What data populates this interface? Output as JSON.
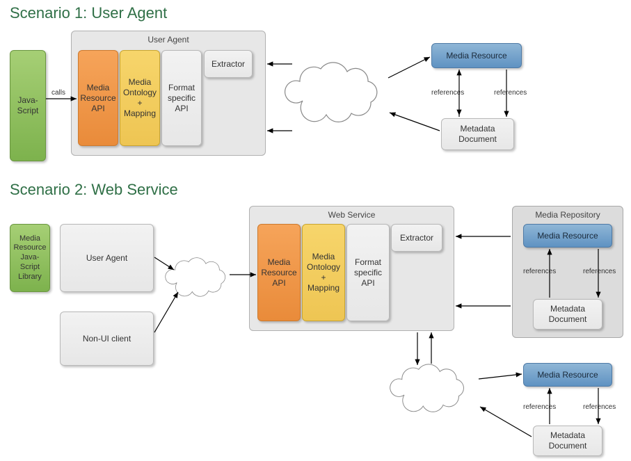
{
  "scenario1": {
    "title": "Scenario 1: User Agent",
    "javascript_box": "Java-\nScript",
    "panel_label": "User Agent",
    "media_resource_api": "Media\nResource\nAPI",
    "media_ontology_mapping": "Media\nOntology\n+\nMapping",
    "format_specific_api": "Format\nspecific\nAPI",
    "extractor": "Extractor",
    "media_resource": "Media Resource",
    "metadata_document": "Metadata\nDocument",
    "calls_label": "calls",
    "references_label_left": "references",
    "references_label_right": "references"
  },
  "scenario2": {
    "title": "Scenario 2: Web Service",
    "js_library_box": "Media\nResource\nJava-\nScript\nLibrary",
    "user_agent_box": "User Agent",
    "non_ui_client_box": "Non-UI client",
    "web_service_panel_label": "Web Service",
    "media_repository_panel_label": "Media Repository",
    "media_resource_api": "Media\nResource\nAPI",
    "media_ontology_mapping": "Media\nOntology\n+\nMapping",
    "format_specific_api": "Format\nspecific\nAPI",
    "extractor": "Extractor",
    "media_resource_repo": "Media Resource",
    "metadata_document_repo": "Metadata\nDocument",
    "media_resource_free": "Media Resource",
    "metadata_document_free": "Metadata\nDocument",
    "references_label_repo_left": "references",
    "references_label_repo_right": "references",
    "references_label_free_left": "references",
    "references_label_free_right": "references"
  }
}
